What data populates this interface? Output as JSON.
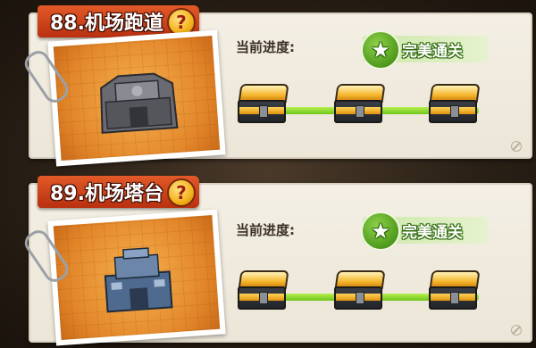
{
  "levels": [
    {
      "title": "88.机场跑道",
      "progress_label": "当前进度:",
      "status": "完美通关",
      "help_icon": "?",
      "star_icon": "★",
      "image_color": "#5f5f66",
      "chest_count": 3
    },
    {
      "title": "89.机场塔台",
      "progress_label": "当前进度:",
      "status": "完美通关",
      "help_icon": "?",
      "star_icon": "★",
      "image_color": "#4f6a8f",
      "chest_count": 3
    }
  ],
  "colors": {
    "title_tab": "#d2461c",
    "status_green": "#4e9a1c",
    "track_green": "#8edc2c",
    "photo_bg": "#e89a3a"
  }
}
